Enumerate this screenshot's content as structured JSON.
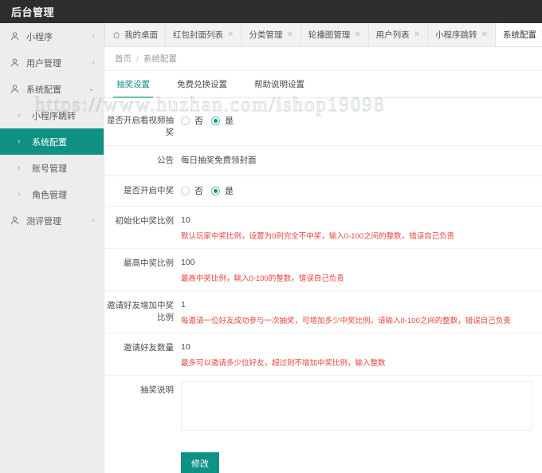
{
  "header": {
    "brand": "后台管理"
  },
  "watermark": {
    "text": "https://www.huzhan.com/ishop19098"
  },
  "sidebar": {
    "items": [
      {
        "label": "小程序",
        "icon": "user-icon",
        "arrow": "‹"
      },
      {
        "label": "用户管理",
        "icon": "user-icon",
        "arrow": "‹"
      },
      {
        "label": "系统配置",
        "icon": "user-icon",
        "arrow": "⌄"
      }
    ],
    "subitems": [
      {
        "label": "小程序跳转",
        "caret": "›",
        "active": false
      },
      {
        "label": "系统配置",
        "caret": "›",
        "active": true
      },
      {
        "label": "账号管理",
        "caret": "›",
        "active": false
      },
      {
        "label": "角色管理",
        "caret": "›",
        "active": false
      }
    ],
    "tail": [
      {
        "label": "测评管理",
        "icon": "user-icon",
        "arrow": "‹"
      }
    ]
  },
  "tabs": [
    {
      "label": "我的桌面",
      "home": true,
      "closable": false,
      "active": false
    },
    {
      "label": "红包封面列表",
      "home": false,
      "closable": true,
      "active": false
    },
    {
      "label": "分类管理",
      "home": false,
      "closable": true,
      "active": false
    },
    {
      "label": "轮播图管理",
      "home": false,
      "closable": true,
      "active": false
    },
    {
      "label": "用户列表",
      "home": false,
      "closable": true,
      "active": false
    },
    {
      "label": "小程序跳转",
      "home": false,
      "closable": true,
      "active": false
    },
    {
      "label": "系统配置",
      "home": false,
      "closable": true,
      "active": true
    }
  ],
  "tab_close_glyph": "✕",
  "breadcrumb": {
    "root": "首页",
    "sep": "/",
    "current": "系统配置"
  },
  "subtabs": [
    {
      "label": "抽奖设置",
      "active": true
    },
    {
      "label": "免费兑换设置",
      "active": false
    },
    {
      "label": "帮助说明设置",
      "active": false
    }
  ],
  "form": {
    "video_lottery": {
      "label": "是否开启看视频抽奖",
      "options": [
        {
          "text": "否",
          "checked": false
        },
        {
          "text": "是",
          "checked": true
        }
      ]
    },
    "notice": {
      "label": "公告",
      "value": "每日抽奖免费领封面",
      "placeholder": ""
    },
    "enable_win": {
      "label": "是否开启中奖",
      "options": [
        {
          "text": "否",
          "checked": false
        },
        {
          "text": "是",
          "checked": true
        }
      ]
    },
    "init_rate": {
      "label": "初始化中奖比例",
      "value": "10",
      "hint": "默认玩家中奖比例，设置为0则完全不中奖，输入0-100之间的整数，错误自己负责"
    },
    "max_rate": {
      "label": "最高中奖比例",
      "value": "100",
      "hint": "最高中奖比例，输入0-100的整数，错误自己负责"
    },
    "invite_rate": {
      "label": "邀请好友增加中奖比例",
      "value": "1",
      "hint": "每邀请一位好友成功参与一次抽奖，可增加多少中奖比例，请输入0-100之间的整数，错误自己负责"
    },
    "invite_count": {
      "label": "邀请好友数量",
      "value": "10",
      "hint": "最多可以邀请多少位好友，超过则不增加中奖比例，输入整数"
    },
    "lottery_desc": {
      "label": "抽奖说明",
      "value": "",
      "placeholder": ""
    },
    "submit_label": "修改"
  },
  "colors": {
    "header_bg": "#2e2e2e",
    "accent": "#0f9184",
    "sidebar_bg": "#ededed",
    "hint_red": "#e8433f"
  }
}
